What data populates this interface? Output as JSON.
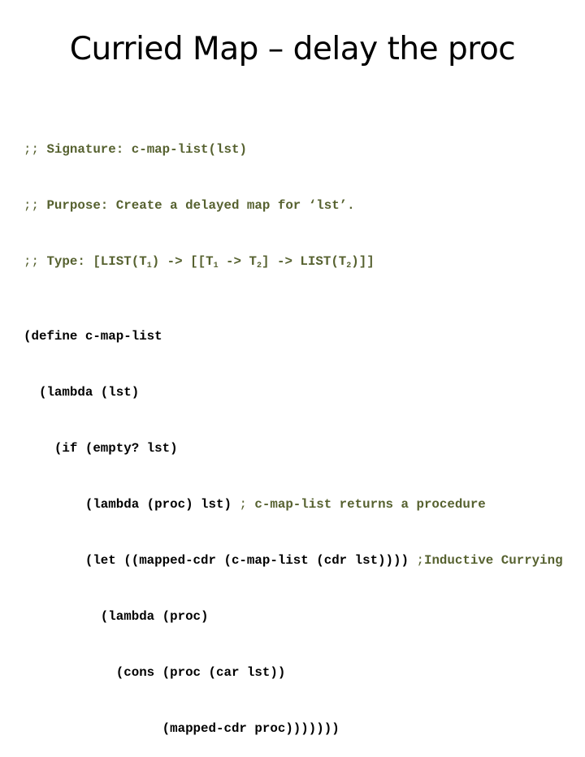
{
  "slide": {
    "title": "Curried Map – delay the proc",
    "colors": {
      "code": "#000000",
      "comment": "#56612f",
      "background": "#ffffff"
    },
    "comments": {
      "signature_prefix": ";; ",
      "signature": "Signature: c-map-list(lst)",
      "purpose_prefix": ";; ",
      "purpose": "Purpose: Create a delayed map for ‘lst’.",
      "type_prefix": ";; ",
      "type_parts": {
        "a": "Type: [LIST(T",
        "sub1": "1",
        "b": ") -> [[T",
        "sub2": "1",
        "c": " -> T",
        "sub3": "2",
        "d": "] -> LIST(T",
        "sub4": "2",
        "e": ")]]"
      }
    },
    "code_lines": [
      {
        "indent": "",
        "text": "(define c-map-list"
      },
      {
        "indent": "  ",
        "text": "(lambda (lst)"
      },
      {
        "indent": "    ",
        "text": "(if (empty? lst)"
      },
      {
        "indent": "        ",
        "text": "(lambda (proc) lst) ",
        "comment_semi": ";",
        "comment": " c-map-list returns a procedure"
      },
      {
        "indent": "        ",
        "text": "(let ((mapped-cdr (c-map-list (cdr lst)))) ",
        "comment_semi": ";",
        "comment": "Inductive Currying"
      },
      {
        "indent": "          ",
        "text": "(lambda (proc)"
      },
      {
        "indent": "            ",
        "text": "(cons (proc (car lst))"
      },
      {
        "indent": "                  ",
        "text": "(mapped-cdr proc)))))))"
      }
    ]
  }
}
